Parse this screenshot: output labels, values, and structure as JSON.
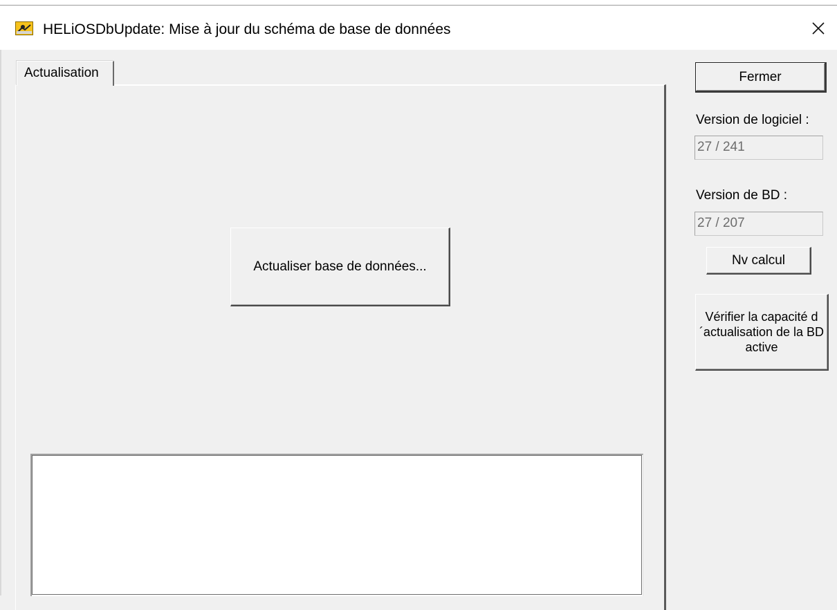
{
  "window": {
    "title": "HELiOSDbUpdate: Mise à jour du schéma de base de données",
    "close_glyph": "✕"
  },
  "tabs": [
    {
      "label": "Actualisation",
      "active": true
    }
  ],
  "main": {
    "update_button_label": "Actualiser base de données...",
    "log_text": ""
  },
  "side": {
    "close_button_label": "Fermer",
    "software_version_label": "Version de logiciel :",
    "software_version_value": "27 / 241",
    "db_version_label": "Version de BD :",
    "db_version_value": "27 / 207",
    "new_calc_button_label": "Nv calcul",
    "verify_button_label": "Vérifier la capacité d´actualisation de la BD active"
  },
  "icons": {
    "app": "heliosdbupdate-app-icon",
    "close": "close-icon"
  },
  "colors": {
    "window_bg": "#f0f0f0",
    "titlebar_bg": "#ffffff",
    "readonly_text": "#6d6d6d",
    "icon_yellow": "#f6c21c"
  }
}
